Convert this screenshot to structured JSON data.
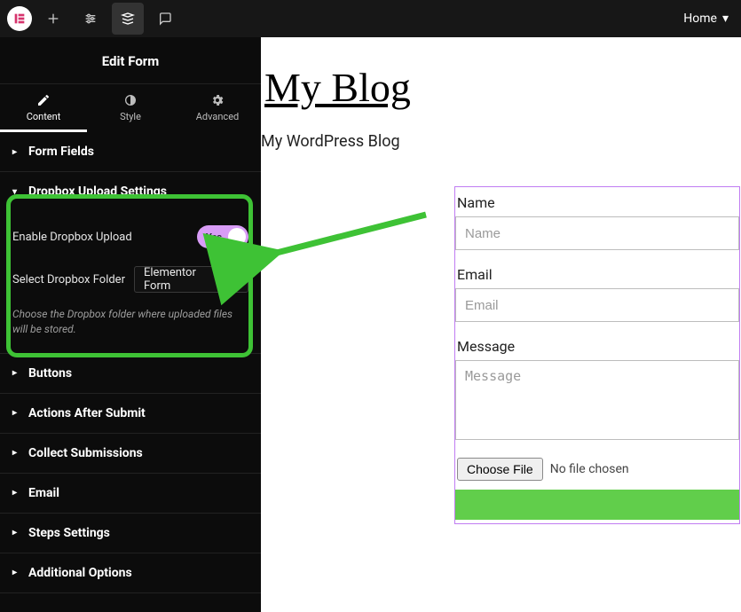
{
  "topbar": {
    "home_label": "Home"
  },
  "panel": {
    "title": "Edit Form",
    "tabs": {
      "content": "Content",
      "style": "Style",
      "advanced": "Advanced"
    },
    "sections": {
      "form_fields": "Form Fields",
      "dropbox": "Dropbox Upload Settings",
      "buttons": "Buttons",
      "actions_after_submit": "Actions After Submit",
      "collect_submissions": "Collect Submissions",
      "email": "Email",
      "steps_settings": "Steps Settings",
      "additional_options": "Additional Options"
    },
    "dropbox": {
      "enable_label": "Enable Dropbox Upload",
      "toggle_text": "Yes",
      "select_label": "Select Dropbox Folder",
      "select_value": "Elementor Form",
      "help": "Choose the Dropbox folder where uploaded files will be stored."
    }
  },
  "preview": {
    "site_title": "My Blog",
    "tagline": "My WordPress Blog",
    "form": {
      "name_label": "Name",
      "name_placeholder": "Name",
      "email_label": "Email",
      "email_placeholder": "Email",
      "message_label": "Message",
      "message_placeholder": "Message",
      "file_button": "Choose File",
      "file_status": "No file chosen"
    }
  }
}
